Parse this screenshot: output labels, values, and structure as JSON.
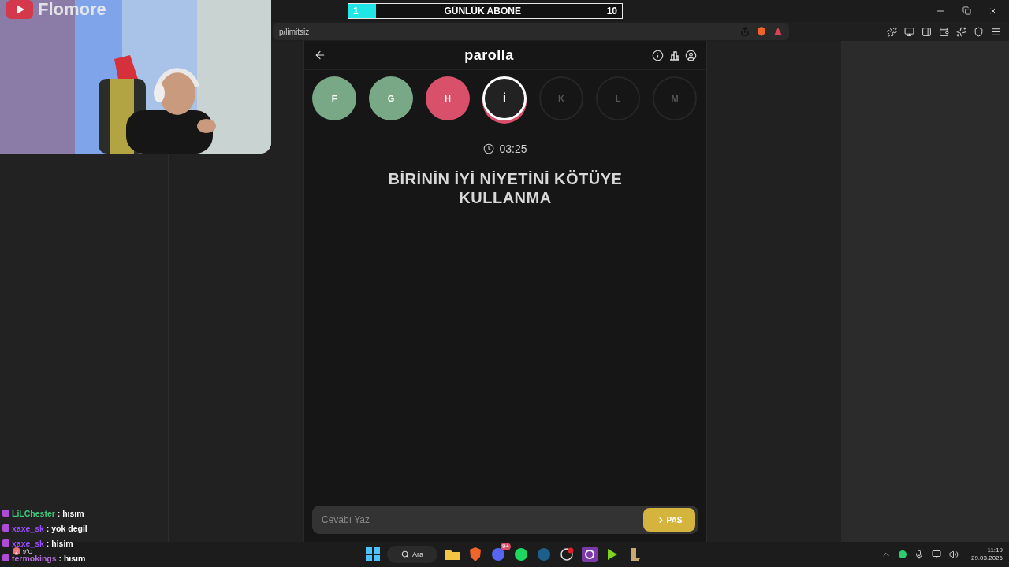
{
  "overlay": {
    "channel_name": "Flomore",
    "subscriber_goal": {
      "current": "1",
      "label": "GÜNLÜK ABONE",
      "target": "10",
      "level": 0.1
    }
  },
  "browser": {
    "address": "p/limitsiz"
  },
  "game": {
    "title": "parolla",
    "letters": [
      {
        "letter": "F",
        "kind": "correct"
      },
      {
        "letter": "G",
        "kind": "correct"
      },
      {
        "letter": "H",
        "kind": "wrong"
      },
      {
        "letter": "İ",
        "kind": "current"
      },
      {
        "letter": "K",
        "kind": "upcoming"
      },
      {
        "letter": "L",
        "kind": "upcoming"
      },
      {
        "letter": "M",
        "kind": "upcoming"
      }
    ],
    "timer": "03:25",
    "question": "BİRİNİN İYİ NİYETİNİ KÖTÜYE KULLANMA",
    "answer": {
      "placeholder": "Cevabı Yaz"
    },
    "pass_button": "PAS"
  },
  "chat": [
    {
      "user": "LiLChester",
      "color": "#3fc77d",
      "message": ": hısım"
    },
    {
      "user": "xaxe_sk",
      "color": "#9b4dff",
      "message": ": yok degil"
    },
    {
      "user": "xaxe_sk",
      "color": "#9b4dff",
      "message": ": hisim"
    },
    {
      "user": "termokings",
      "color": "#b26bd9",
      "message": ": hısım"
    }
  ],
  "weather": {
    "temperature": "9°C",
    "badge": "2"
  },
  "taskbar": {
    "search_label": "Ara",
    "app_badge": "9+",
    "time": "11:19",
    "date": "29.03.2026"
  }
}
